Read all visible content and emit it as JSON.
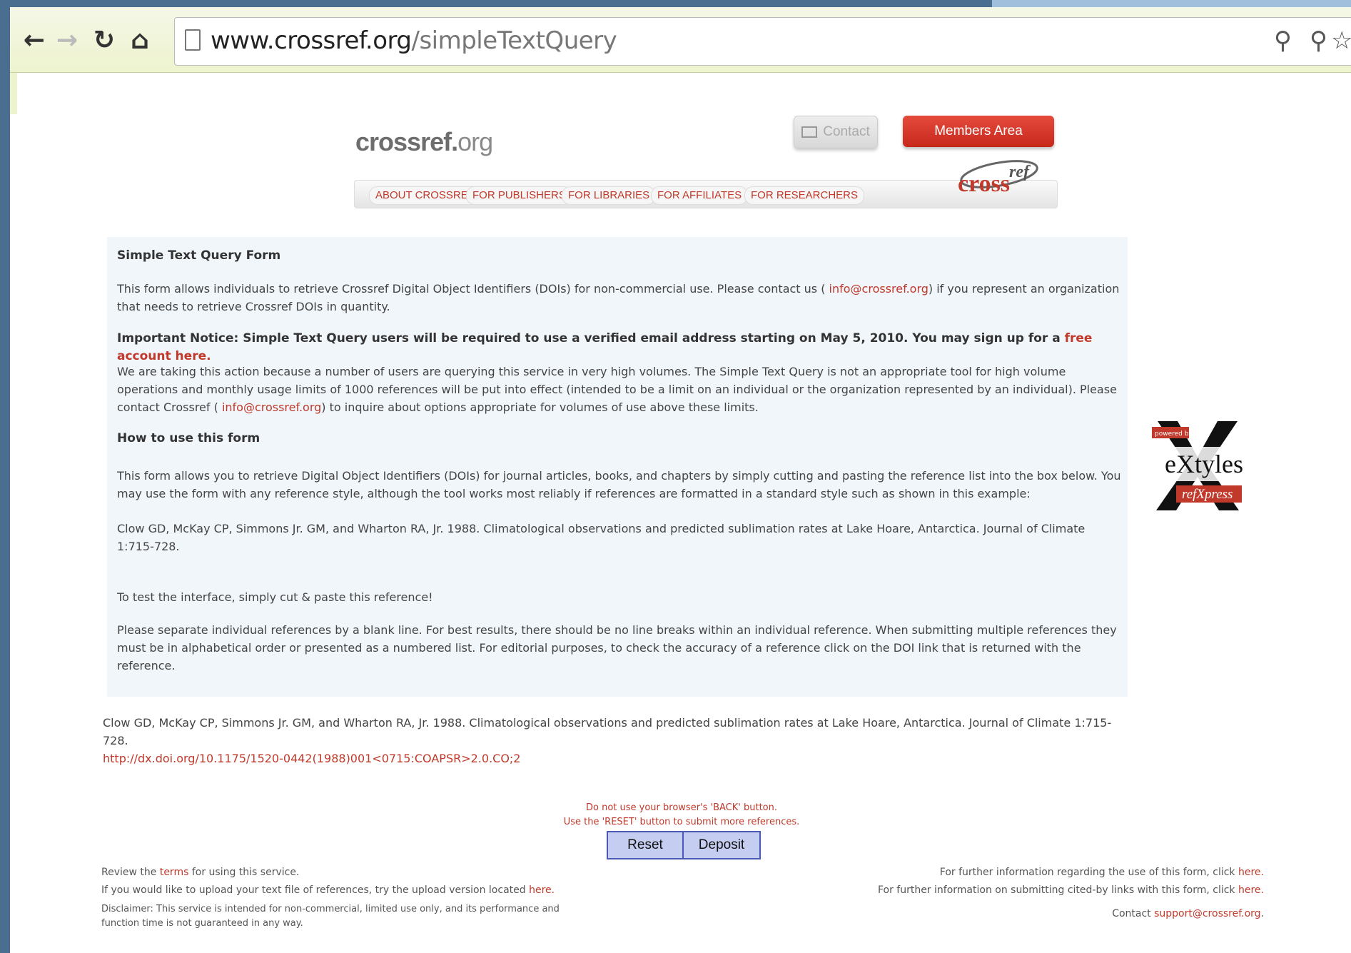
{
  "browser": {
    "url_host": "www.crossref.org",
    "url_path": "/simpleTextQuery",
    "icons": [
      "back-arrow-icon",
      "forward-arrow-icon",
      "reload-icon",
      "home-icon",
      "page-icon",
      "zoom-icon",
      "key-icon",
      "star-icon"
    ]
  },
  "header": {
    "logo_main": "crossref.",
    "logo_tld": "org",
    "contact_label": "Contact",
    "members_label": "Members Area",
    "nav": [
      "ABOUT CROSSREF",
      "FOR PUBLISHERS",
      "FOR LIBRARIES",
      "FOR AFFILIATES",
      "FOR RESEARCHERS"
    ],
    "cross_logo_word": "cross",
    "cross_logo_sup": "ref"
  },
  "content": {
    "title": "Simple Text Query Form",
    "intro_1": "This form allows individuals to retrieve Crossref Digital Object Identifiers (DOIs) for non-commercial use. Please contact us ( ",
    "intro_email": "info@crossref.org",
    "intro_2": ") if you represent an organization that needs to retrieve Crossref DOIs in quantity.",
    "notice_text": "Important Notice: Simple Text Query users will be required to use a verified email address starting on May 5, 2010. You may sign up for a ",
    "notice_link": "free account here.",
    "action_1": "We are taking this action because a number of users are querying this service in very high volumes. The Simple Text Query is not an appropriate tool for high volume operations and monthly usage limits of 1000 references will be put into effect (intended to be a limit on an individual or the organization represented by an individual). Please contact Crossref ( ",
    "action_email": "info@crossref.org",
    "action_2": ") to inquire about options appropriate for volumes of use above these limits.",
    "how_heading": "How to use this form",
    "how_text": "This form allows you to retrieve Digital Object Identifiers (DOIs) for journal articles, books, and chapters by simply cutting and pasting the reference list into the box below. You may use the form with any reference style, although the tool works most reliably if references are formatted in a standard style such as shown in this example:",
    "example_ref": "Clow GD, McKay CP, Simmons Jr. GM, and Wharton RA, Jr. 1988. Climatological observations and predicted sublimation rates at Lake Hoare, Antarctica. Journal of Climate 1:715-728.",
    "test_text": "To test the interface, simply cut & paste this reference!",
    "separate_text": "Please separate individual references by a blank line. For best results, there should be no line breaks within an individual reference. When submitting multiple references they must be in alphabetical order or presented as a numbered list. For editorial purposes, to check the accuracy of a reference click on the DOI link that is returned with the reference."
  },
  "extyles": {
    "powered_by": "powered by",
    "name": "eXtyles",
    "sub": "refXpress"
  },
  "result": {
    "citation": "Clow GD, McKay CP, Simmons Jr. GM, and Wharton RA, Jr. 1988. Climatological observations and predicted sublimation rates at Lake Hoare, Antarctica. Journal of Climate 1:715-728.",
    "doi_link": "http://dx.doi.org/10.1175/1520-0442(1988)001<0715:COAPSR>2.0.CO;2"
  },
  "controls": {
    "warning_1": "Do not use your browser's 'BACK' button.",
    "warning_2": "Use the 'RESET' button to submit more references.",
    "reset_label": "Reset",
    "deposit_label": "Deposit"
  },
  "footer": {
    "terms_1": "Review the ",
    "terms_link": "terms",
    "terms_2": " for using this service.",
    "upload_1": "If you would like to upload your text file of references, try the upload version located ",
    "upload_link": "here.",
    "disclaimer": "Disclaimer: This service is intended for non-commercial, limited use only, and its performance and function time is not guaranteed in any way.",
    "info_1": "For further information regarding the use of this form, click ",
    "info_1_link": "here.",
    "info_2": "For further information on submitting cited-by links with this form, click ",
    "info_2_link": "here.",
    "contact_1": "Contact ",
    "contact_link": "support@crossref.org",
    "contact_2": "."
  }
}
